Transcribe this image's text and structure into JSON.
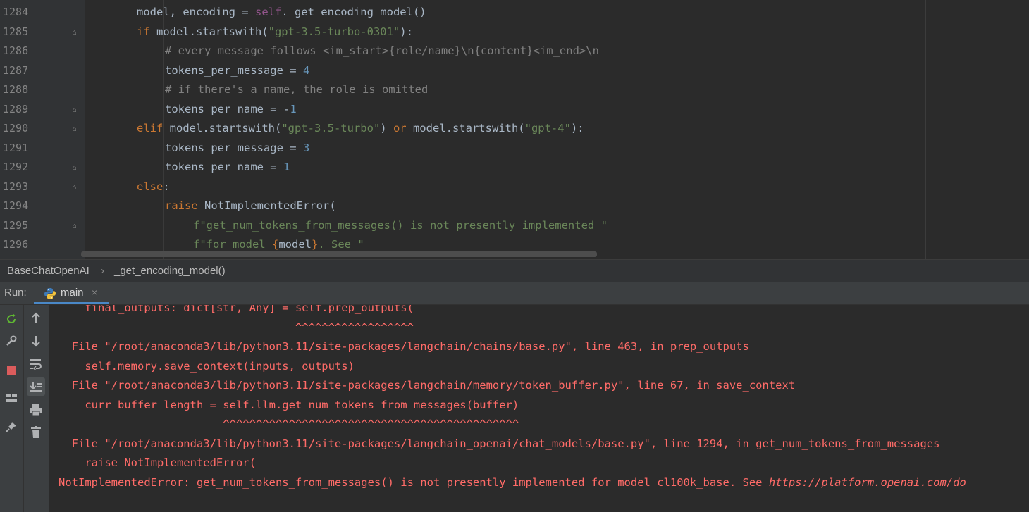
{
  "editor": {
    "line_numbers": [
      "1284",
      "1285",
      "1286",
      "1287",
      "1288",
      "1289",
      "1290",
      "1291",
      "1292",
      "1293",
      "1294",
      "1295",
      "1296"
    ],
    "lines": [
      {
        "indent": 2,
        "tokens": [
          [
            "model, encoding = ",
            "p"
          ],
          [
            "self",
            "self"
          ],
          [
            "._get_encoding_model()",
            "p"
          ]
        ]
      },
      {
        "indent": 2,
        "tokens": [
          [
            "if ",
            "kw"
          ],
          [
            "model.startswith(",
            "p"
          ],
          [
            "\"gpt-3.5-turbo-0301\"",
            "str"
          ],
          [
            "):",
            "p"
          ]
        ]
      },
      {
        "indent": 3,
        "tokens": [
          [
            "# every message follows <im_start>{role/name}\\n{content}<im_end>\\n",
            "com"
          ]
        ]
      },
      {
        "indent": 3,
        "tokens": [
          [
            "tokens_per_message = ",
            "p"
          ],
          [
            "4",
            "num"
          ]
        ]
      },
      {
        "indent": 3,
        "tokens": [
          [
            "# if there's a name, the role is omitted",
            "com"
          ]
        ]
      },
      {
        "indent": 3,
        "tokens": [
          [
            "tokens_per_name = -",
            "p"
          ],
          [
            "1",
            "num"
          ]
        ]
      },
      {
        "indent": 2,
        "tokens": [
          [
            "elif ",
            "kw"
          ],
          [
            "model.startswith(",
            "p"
          ],
          [
            "\"gpt-3.5-turbo\"",
            "str"
          ],
          [
            ") ",
            "p"
          ],
          [
            "or ",
            "kw"
          ],
          [
            "model.startswith(",
            "p"
          ],
          [
            "\"gpt-4\"",
            "str"
          ],
          [
            "):",
            "p"
          ]
        ]
      },
      {
        "indent": 3,
        "tokens": [
          [
            "tokens_per_message = ",
            "p"
          ],
          [
            "3",
            "num"
          ]
        ]
      },
      {
        "indent": 3,
        "tokens": [
          [
            "tokens_per_name = ",
            "p"
          ],
          [
            "1",
            "num"
          ]
        ]
      },
      {
        "indent": 2,
        "tokens": [
          [
            "else",
            "kw"
          ],
          [
            ":",
            "p"
          ]
        ]
      },
      {
        "indent": 3,
        "tokens": [
          [
            "raise ",
            "kw"
          ],
          [
            "NotImplementedError",
            "cls"
          ],
          [
            "(",
            "p"
          ]
        ]
      },
      {
        "indent": 4,
        "tokens": [
          [
            "f\"get_num_tokens_from_messages() is not presently implemented \"",
            "str"
          ]
        ]
      },
      {
        "indent": 4,
        "tokens": [
          [
            "f\"for model ",
            "str"
          ],
          [
            "{",
            "kw"
          ],
          [
            "model",
            "p"
          ],
          [
            "}",
            "kw"
          ],
          [
            ". See \"",
            "str"
          ]
        ]
      }
    ]
  },
  "breadcrumb": {
    "class_name": "BaseChatOpenAI",
    "separator": "›",
    "method_name": "_get_encoding_model()"
  },
  "run": {
    "label": "Run:",
    "tab_name": "main",
    "close_glyph": "×"
  },
  "console": {
    "lines": [
      "    final_outputs: dict[str, Any] = self.prep_outputs(",
      "                                    ^^^^^^^^^^^^^^^^^^",
      "  File \"/root/anaconda3/lib/python3.11/site-packages/langchain/chains/base.py\", line 463, in prep_outputs",
      "    self.memory.save_context(inputs, outputs)",
      "  File \"/root/anaconda3/lib/python3.11/site-packages/langchain/memory/token_buffer.py\", line 67, in save_context",
      "    curr_buffer_length = self.llm.get_num_tokens_from_messages(buffer)",
      "                         ^^^^^^^^^^^^^^^^^^^^^^^^^^^^^^^^^^^^^^^^^^^^^",
      "  File \"/root/anaconda3/lib/python3.11/site-packages/langchain_openai/chat_models/base.py\", line 1294, in get_num_tokens_from_messages",
      "    raise NotImplementedError("
    ],
    "error_prefix": "NotImplementedError: get_num_tokens_from_messages() is not presently implemented for model cl100k_base. See ",
    "error_link": "https://platform.openai.com/do"
  },
  "colors": {
    "editor_bg": "#2b2b2b",
    "error_text": "#ff6b68",
    "keyword": "#cc7832",
    "string": "#6a8759",
    "number": "#6897bb",
    "comment": "#808080",
    "active_tab_underline": "#4a88c7"
  },
  "icons": {
    "left_toolbar": [
      "rerun-icon",
      "wrench-icon",
      "stop-icon",
      "layout-icon",
      "pin-icon"
    ],
    "console_toolbar": [
      "arrow-up-icon",
      "arrow-down-icon",
      "soft-wrap-icon",
      "scroll-to-end-icon",
      "print-icon",
      "trash-icon"
    ]
  }
}
